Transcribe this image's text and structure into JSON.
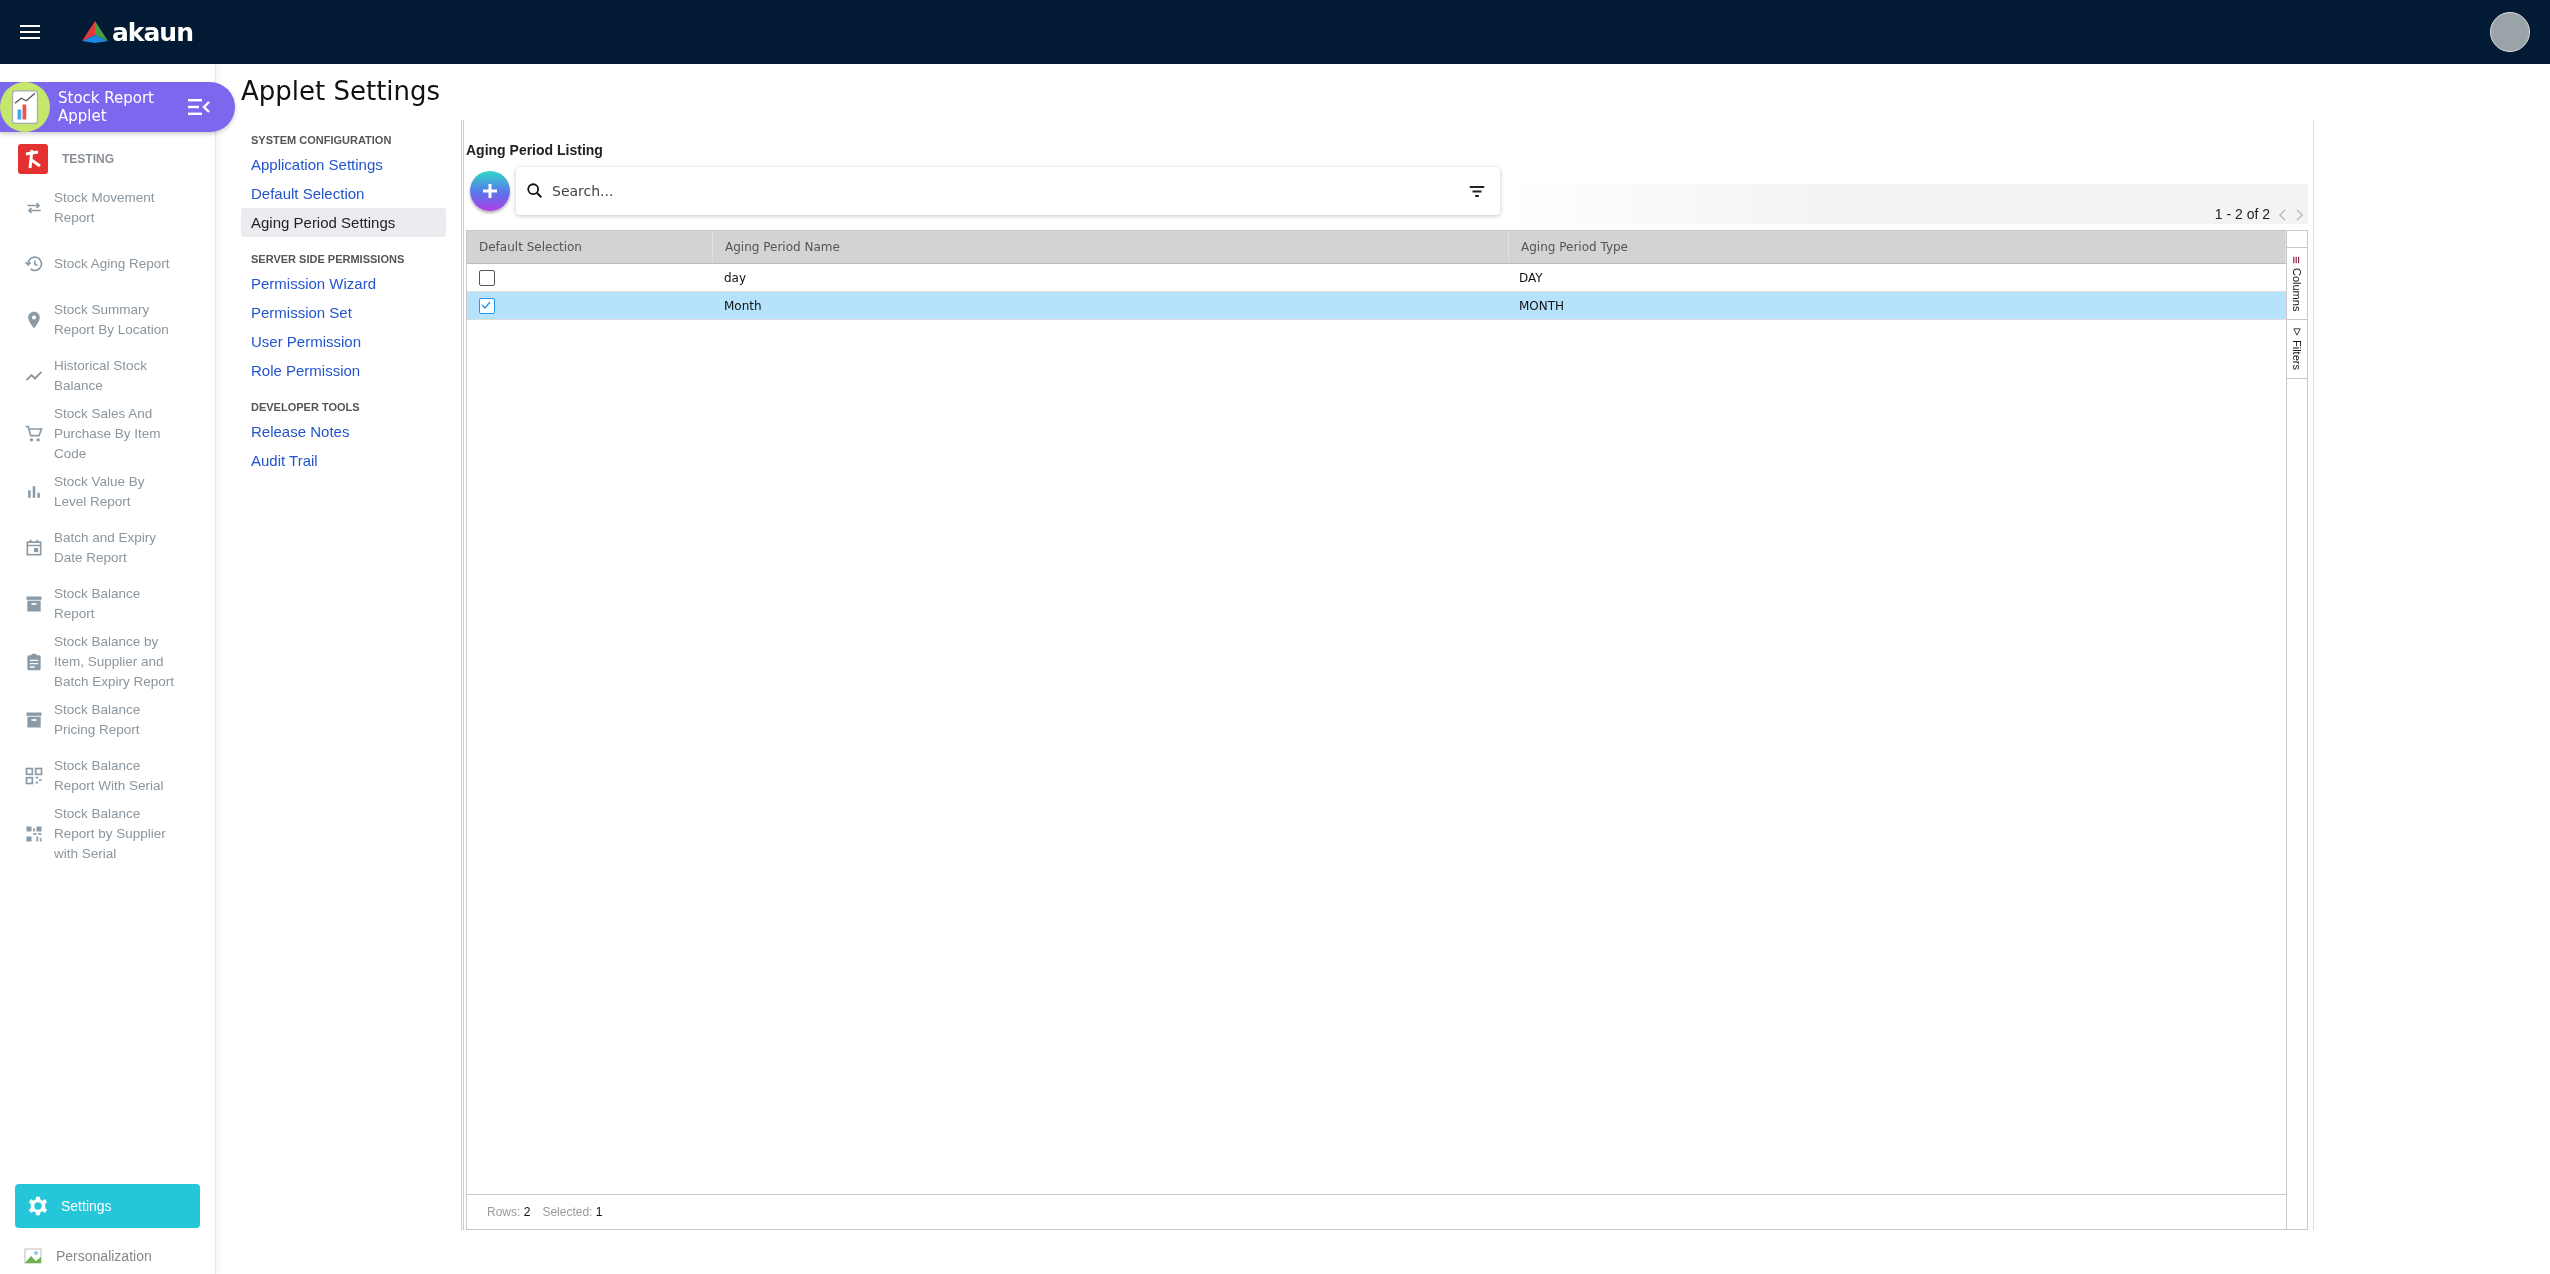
{
  "top_bar": {
    "logo_text": "akaun"
  },
  "sidebar": {
    "applet_title": "Stock Report Applet",
    "group_label": "TESTING",
    "items": [
      {
        "label": "Stock Movement Report"
      },
      {
        "label": "Stock Aging Report"
      },
      {
        "label": "Stock Summary Report By Location"
      },
      {
        "label": "Historical Stock Balance"
      },
      {
        "label": "Stock Sales And Purchase By Item Code"
      },
      {
        "label": "Stock Value By Level Report"
      },
      {
        "label": "Batch and Expiry Date Report"
      },
      {
        "label": "Stock Balance Report"
      },
      {
        "label": "Stock Balance by Item, Supplier and Batch Expiry Report"
      },
      {
        "label": "Stock Balance Pricing Report"
      },
      {
        "label": "Stock Balance Report With Serial"
      },
      {
        "label": "Stock Balance Report by Supplier with Serial"
      }
    ],
    "settings_button": "Settings",
    "personalization": "Personalization"
  },
  "page_title": "Applet Settings",
  "settings_nav": [
    {
      "heading": "SYSTEM CONFIGURATION",
      "items": [
        {
          "label": "Application Settings",
          "selected": false
        },
        {
          "label": "Default Selection",
          "selected": false
        },
        {
          "label": "Aging Period Settings",
          "selected": true
        }
      ]
    },
    {
      "heading": "SERVER SIDE PERMISSIONS",
      "items": [
        {
          "label": "Permission Wizard",
          "selected": false
        },
        {
          "label": "Permission Set",
          "selected": false
        },
        {
          "label": "User Permission",
          "selected": false
        },
        {
          "label": "Role Permission",
          "selected": false
        }
      ]
    },
    {
      "heading": "DEVELOPER TOOLS",
      "items": [
        {
          "label": "Release Notes",
          "selected": false
        },
        {
          "label": "Audit Trail",
          "selected": false
        }
      ]
    }
  ],
  "listing": {
    "title": "Aging Period Listing",
    "search": {
      "placeholder": "Search..."
    },
    "pagination": "1 - 2 of 2",
    "table": {
      "columns": [
        "Default Selection",
        "Aging Period Name",
        "Aging Period Type"
      ],
      "rows": [
        {
          "checked": false,
          "selected": false,
          "name": "day",
          "type": "DAY"
        },
        {
          "checked": true,
          "selected": true,
          "name": "Month",
          "type": "MONTH"
        }
      ]
    },
    "side_tabs": [
      "Columns",
      "Filters"
    ],
    "footer": [
      {
        "label": "Rows:",
        "value": "2"
      },
      {
        "label": "Selected:",
        "value": "1"
      }
    ]
  }
}
